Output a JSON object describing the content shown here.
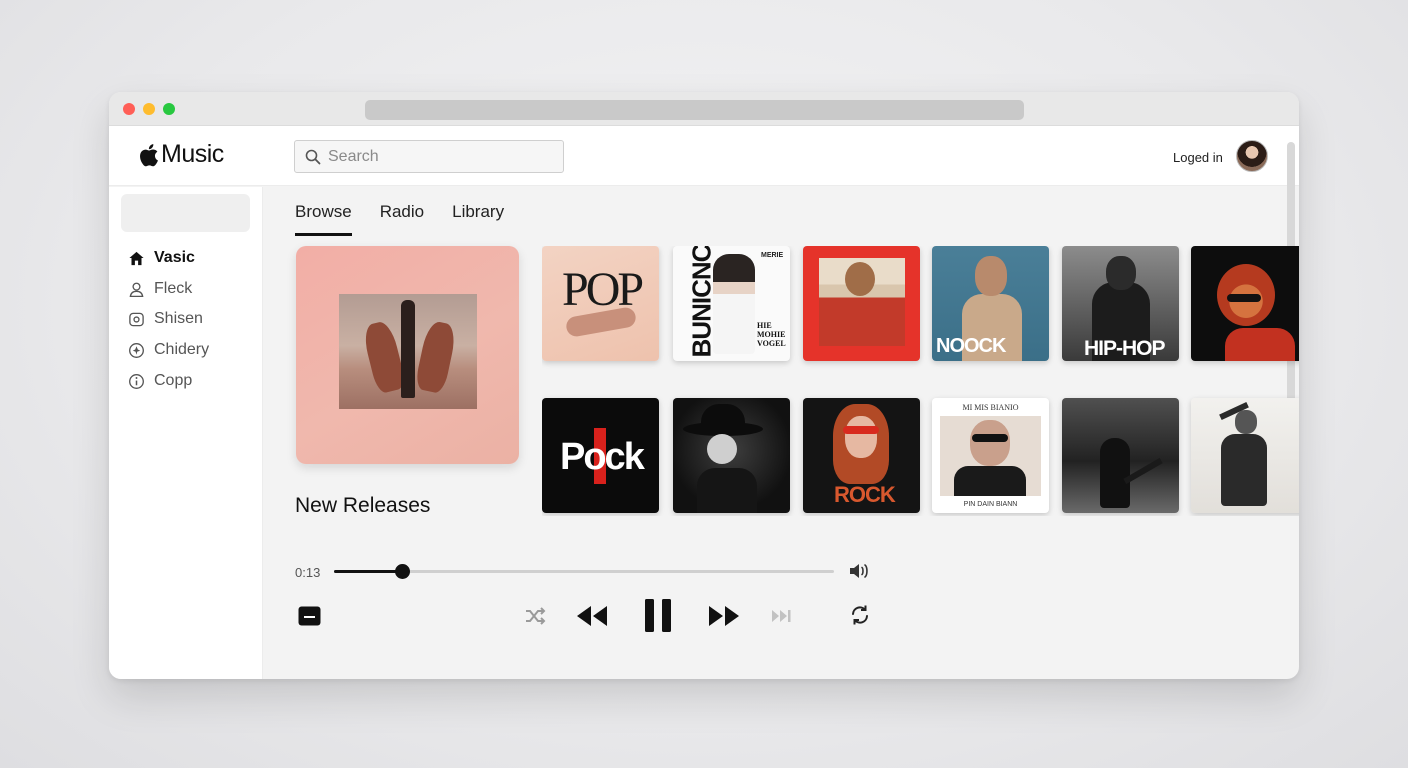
{
  "app": {
    "logo_text": "Music",
    "search_placeholder": "Search",
    "login_status": "Loged in"
  },
  "sidebar": {
    "items": [
      {
        "label": "Vasic",
        "icon": "home-icon",
        "active": true
      },
      {
        "label": "Fleck",
        "icon": "person-icon",
        "active": false
      },
      {
        "label": "Shisen",
        "icon": "radio-icon",
        "active": false
      },
      {
        "label": "Chidery",
        "icon": "compass-icon",
        "active": false
      },
      {
        "label": "Copp",
        "icon": "info-icon",
        "active": false
      }
    ]
  },
  "tabs": [
    {
      "label": "Browse",
      "active": true
    },
    {
      "label": "Radio",
      "active": false
    },
    {
      "label": "Library",
      "active": false
    }
  ],
  "section_title": "New Releases",
  "albums_row1": [
    {
      "title": "POP",
      "style": "pop-peach"
    },
    {
      "title": "BUNICNC",
      "sub": "HIE MOHIE VOGEL",
      "corner": "MERIE",
      "style": "magazine-white"
    },
    {
      "title": "",
      "style": "red-frame"
    },
    {
      "title": "NOOCK",
      "style": "blue-portrait"
    },
    {
      "title": "HIP-HOP",
      "style": "bw-portrait"
    },
    {
      "title": "",
      "style": "red-sunglasses"
    }
  ],
  "albums_row2": [
    {
      "title": "Pock",
      "style": "black-pock"
    },
    {
      "title": "",
      "style": "hat-silhouette"
    },
    {
      "title": "ROCK",
      "style": "redhead-rock"
    },
    {
      "title": "",
      "caption_top": "MI MIS BIANIO",
      "caption_bottom": "PIN DAIN BIANN",
      "style": "white-sunglasses"
    },
    {
      "title": "",
      "style": "bw-guitar"
    },
    {
      "title": "",
      "style": "bw-saluting"
    }
  ],
  "player": {
    "current_time": "0:13",
    "progress": 0.135,
    "state": "playing"
  },
  "colors": {
    "accent_red": "#e5332a",
    "pop_peach": "#f2c4b0",
    "feature_pink": "#f2aea6"
  }
}
